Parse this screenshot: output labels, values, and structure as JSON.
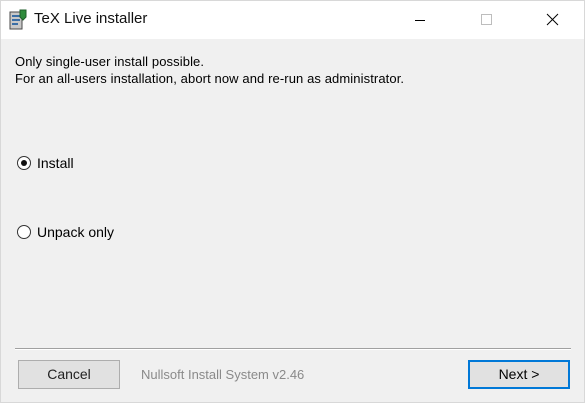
{
  "window": {
    "title": "TeX Live installer"
  },
  "message": {
    "line1": "Only single-user install possible.",
    "line2": "For an all-users installation, abort now and re-run as administrator."
  },
  "options": [
    {
      "label": "Install",
      "selected": true
    },
    {
      "label": "Unpack only",
      "selected": false
    }
  ],
  "footer": {
    "cancel_label": "Cancel",
    "branding": "Nullsoft Install System v2.46",
    "next_label": "Next >"
  },
  "colors": {
    "window_bg": "#f0f0f0",
    "titlebar_bg": "#ffffff",
    "default_button_border": "#0078d7",
    "branding_text": "#8a8a8a"
  },
  "icons": {
    "app": "tex-live-installer-icon",
    "minimize": "minimize-icon",
    "maximize": "maximize-icon",
    "close": "close-icon"
  }
}
